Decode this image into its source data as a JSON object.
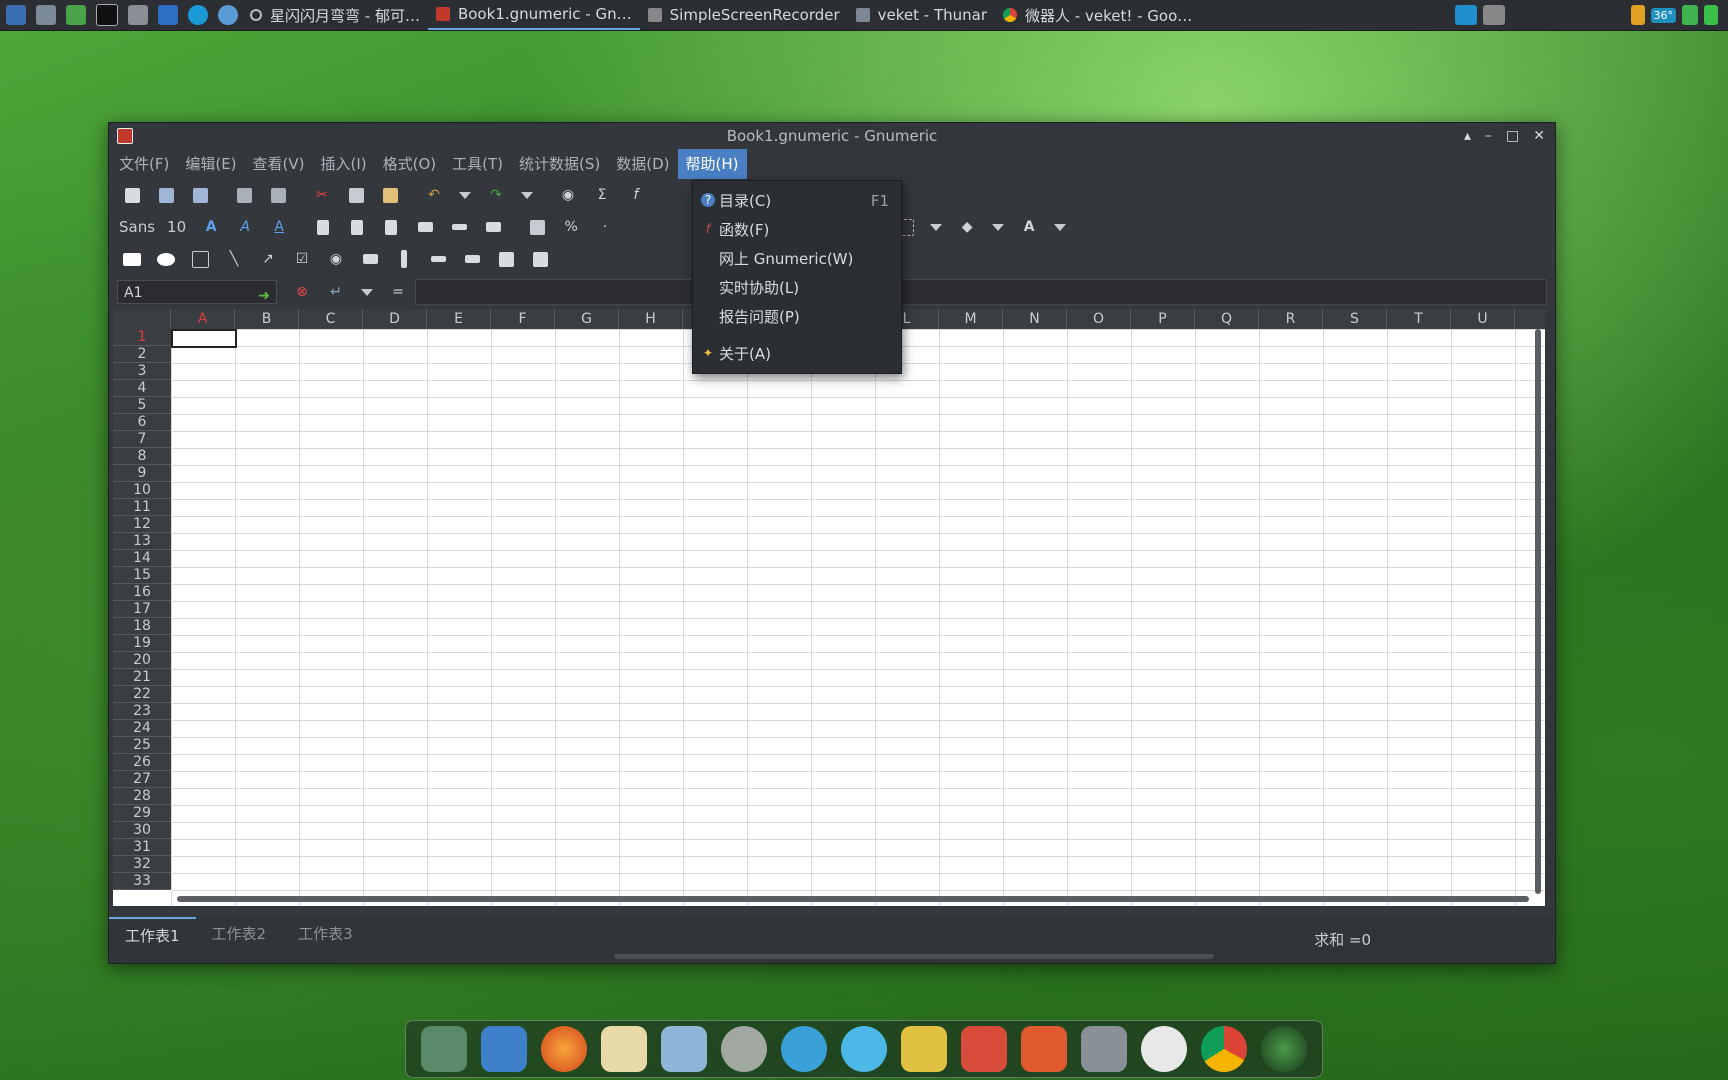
{
  "taskbar": {
    "tasks": [
      {
        "label": "星闪闪月弯弯 - 郁可…"
      },
      {
        "label": "Book1.gnumeric - Gn…"
      },
      {
        "label": "SimpleScreenRecorder"
      },
      {
        "label": "veket - Thunar"
      },
      {
        "label": "微器人 - veket! - Goo…"
      }
    ],
    "tray_temp": "36°"
  },
  "window": {
    "title": "Book1.gnumeric - Gnumeric",
    "controls": {
      "up": "▴",
      "minimize": "–",
      "maximize": "□",
      "close": "✕"
    }
  },
  "menubar": [
    "文件(F)",
    "编辑(E)",
    "查看(V)",
    "插入(I)",
    "格式(O)",
    "工具(T)",
    "统计数据(S)",
    "数据(D)",
    "帮助(H)"
  ],
  "format_toolbar": {
    "font_name": "Sans",
    "font_size": "10",
    "percent": "%"
  },
  "formula": {
    "cell_ref": "A1",
    "equals": "=",
    "value": ""
  },
  "columns": [
    "A",
    "B",
    "C",
    "D",
    "E",
    "F",
    "G",
    "H",
    "I",
    "J",
    "K",
    "L",
    "M",
    "N",
    "O",
    "P",
    "Q",
    "R",
    "S",
    "T",
    "U"
  ],
  "rows": [
    "1",
    "2",
    "3",
    "4",
    "5",
    "6",
    "7",
    "8",
    "9",
    "10",
    "11",
    "12",
    "13",
    "14",
    "15",
    "16",
    "17",
    "18",
    "19",
    "20",
    "21",
    "22",
    "23",
    "24",
    "25",
    "26",
    "27",
    "28",
    "29",
    "30",
    "31",
    "32",
    "33"
  ],
  "help_menu": {
    "items": [
      {
        "label": "目录(C)",
        "shortcut": "F1",
        "icon": "help-icon"
      },
      {
        "label": "函数(F)",
        "shortcut": "",
        "icon": "function-icon"
      },
      {
        "label": "网上 Gnumeric(W)",
        "shortcut": ""
      },
      {
        "label": "实时协助(L)",
        "shortcut": ""
      },
      {
        "label": "报告问题(P)",
        "shortcut": ""
      },
      {
        "label": "关于(A)",
        "shortcut": "",
        "icon": "star-icon"
      }
    ]
  },
  "sheets": [
    "工作表1",
    "工作表2",
    "工作表3"
  ],
  "status": {
    "sum": "求和 =0"
  },
  "colors": {
    "accent": "#4a7fc4",
    "selected_header": "#e03c3c",
    "wallpaper_text": "#e8331f"
  }
}
